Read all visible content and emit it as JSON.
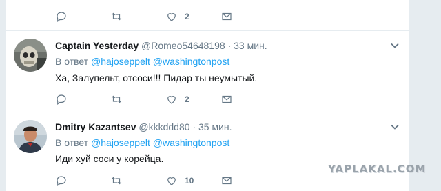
{
  "top_tweet": {
    "likes": "2"
  },
  "tweets": [
    {
      "name": "Captain Yesterday",
      "handle": "@Romeo54648198",
      "separator": "·",
      "time": "33 мин.",
      "reply_prefix": "В ответ",
      "mentions": [
        "@hajoseppelt",
        "@washingtonpost"
      ],
      "text": "Ха, Залупельт, отсоси!!! Пидар ты неумытый.",
      "likes": "2"
    },
    {
      "name": "Dmitry Kazantsev",
      "handle": "@kkkddd80",
      "separator": "·",
      "time": "35 мин.",
      "reply_prefix": "В ответ",
      "mentions": [
        "@hajoseppelt",
        "@washingtonpost"
      ],
      "text": "Иди хуй соси у корейца.",
      "likes": "10"
    }
  ],
  "watermark": "YAPLAKAL.COM",
  "icons": [
    "reply-icon",
    "retweet-icon",
    "like-icon",
    "message-icon",
    "chevron-down-icon"
  ]
}
